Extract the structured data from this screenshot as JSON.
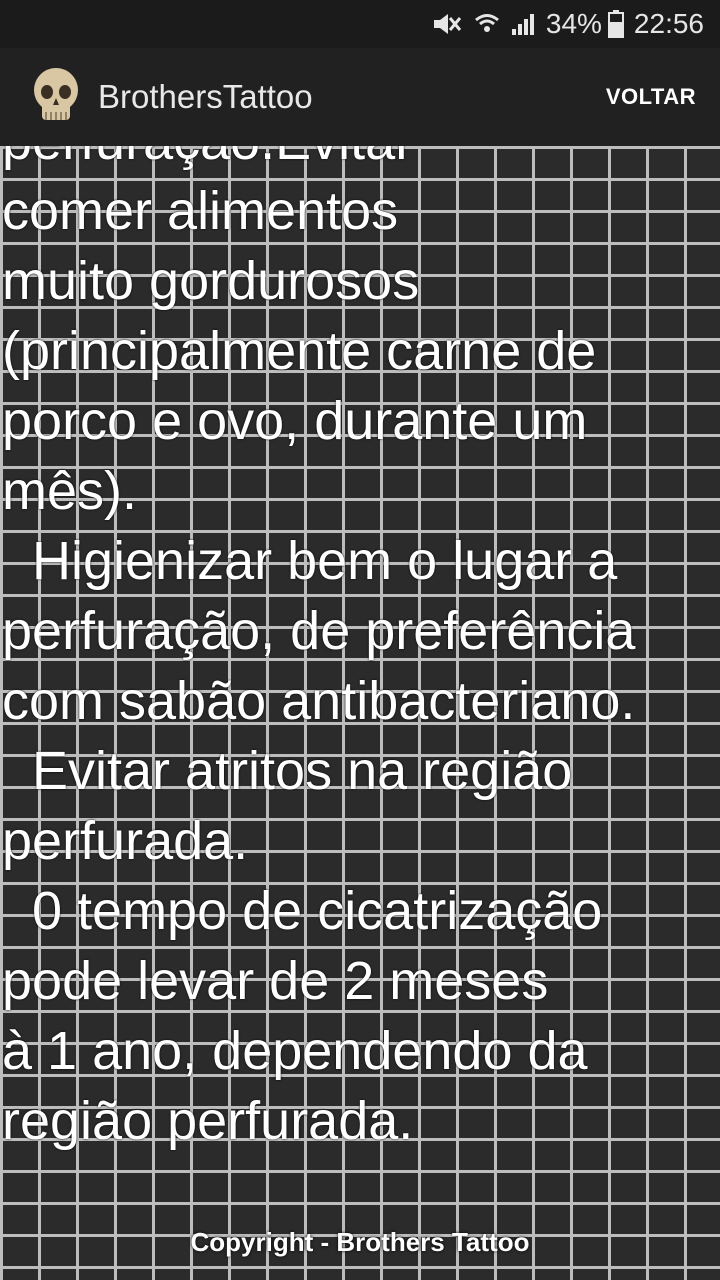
{
  "status_bar": {
    "battery": "34%",
    "time": "22:56",
    "icons": [
      "mute-icon",
      "wifi-icon",
      "signal-icon",
      "battery-icon"
    ]
  },
  "app_bar": {
    "title": "BrothersTattoo",
    "back_label": "VOLTAR",
    "logo_icon": "skull-icon"
  },
  "article": {
    "lines": [
      "perfuração.Evitar",
      "comer alimentos",
      "muito gordurosos",
      "(principalmente carne de",
      "porco e ovo, durante um",
      "mês).",
      "Higienizar bem o lugar a",
      "perfuração, de preferência",
      "com sabão antibacteriano.",
      "Evitar atritos na região",
      "perfurada.",
      "0 tempo de cicatrização",
      "pode levar de 2 meses",
      "à 1 ano, dependendo da",
      "região perfurada."
    ]
  },
  "footer": {
    "copyright": "Copyright - Brothers Tattoo"
  },
  "colors": {
    "status_bar": "#1b1b1b",
    "app_bar": "#212121",
    "brick": "#2b2b2b",
    "mortar": "#bdbdbd",
    "text": "#ffffff"
  }
}
